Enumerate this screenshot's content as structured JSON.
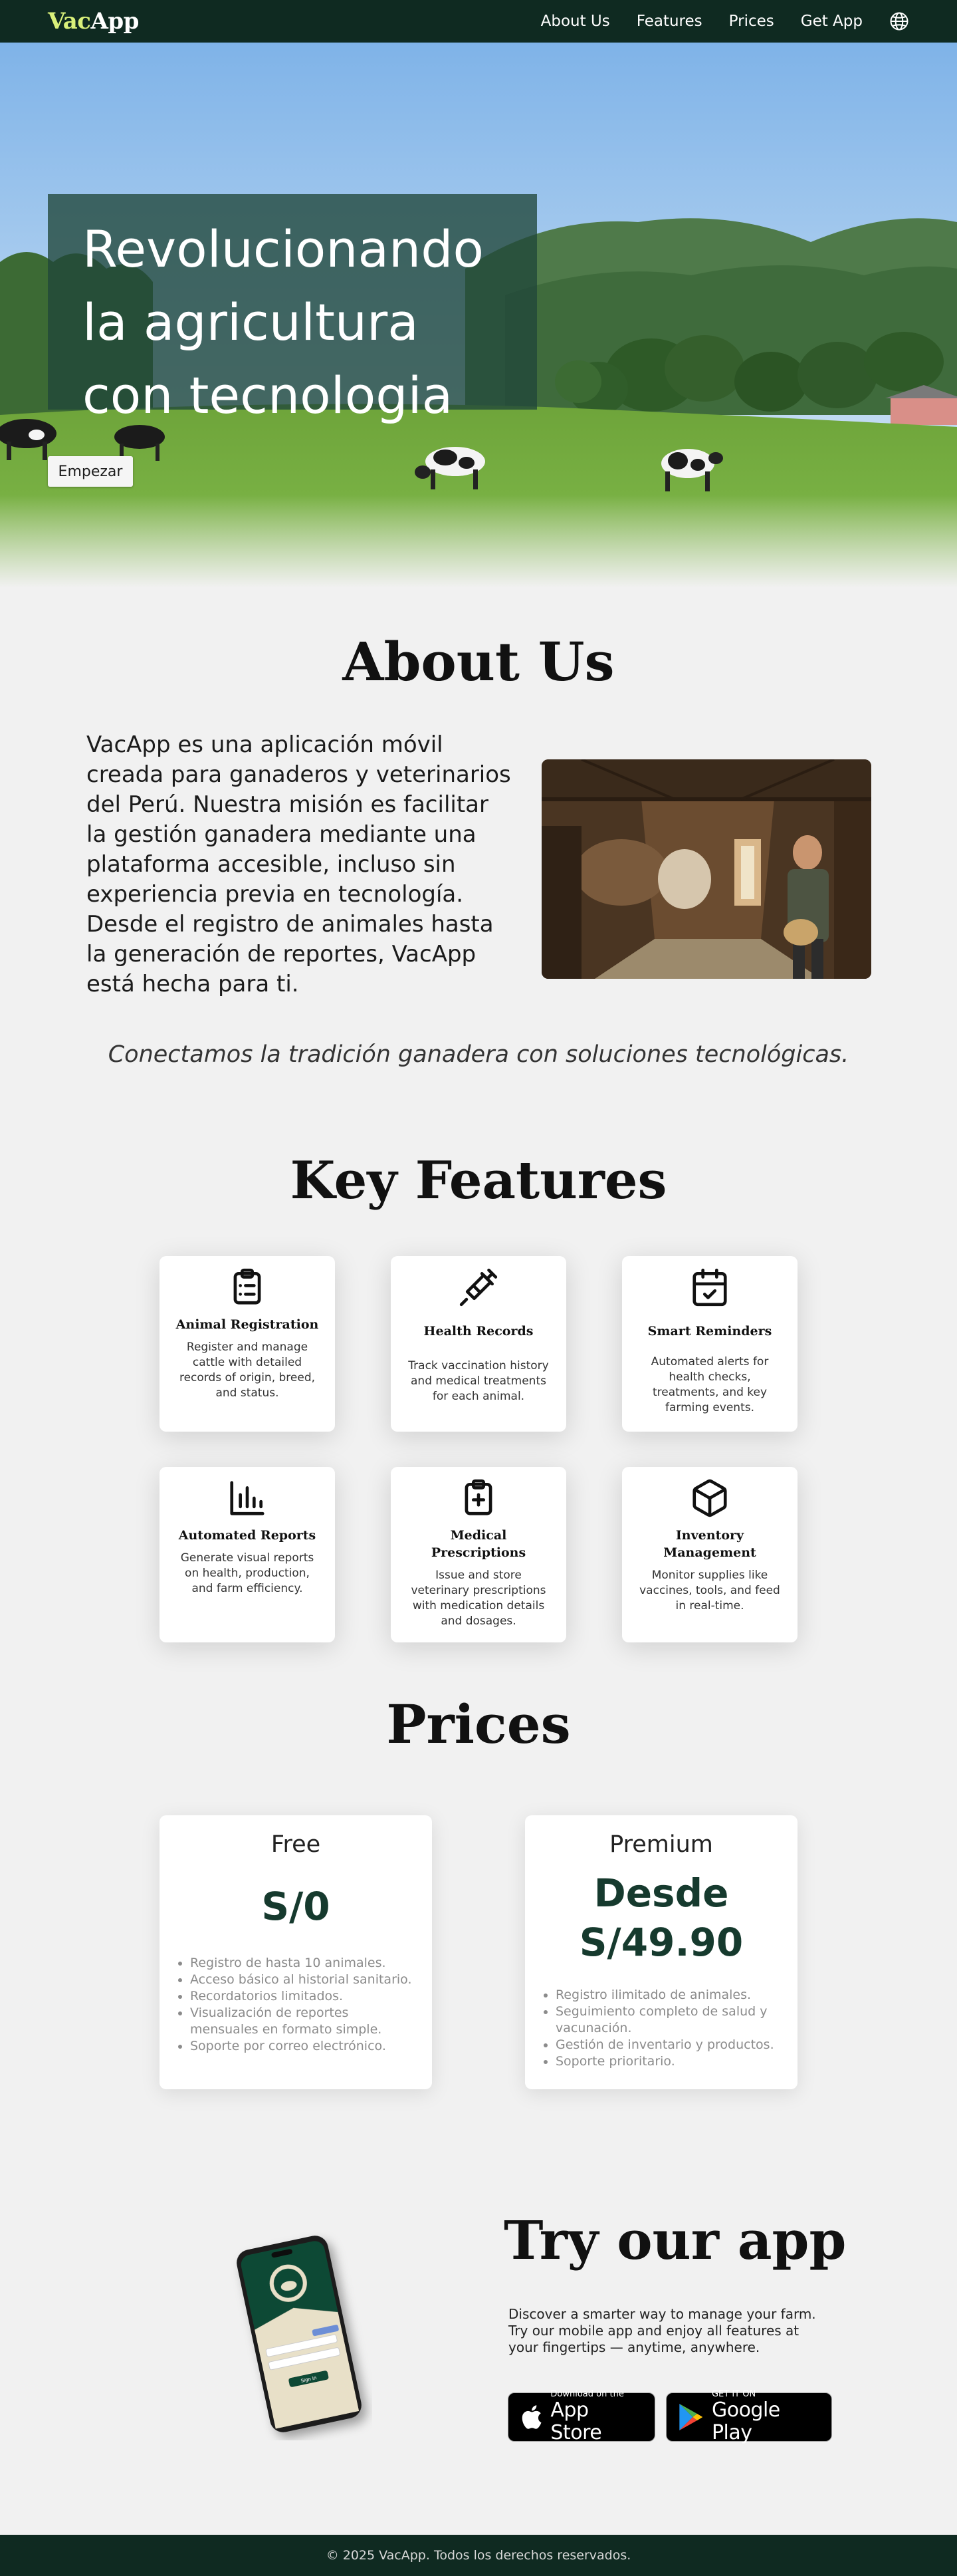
{
  "nav": {
    "brand_prefix": "Vac",
    "brand_suffix": "App",
    "links": [
      "About Us",
      "Features",
      "Prices",
      "Get App"
    ],
    "language_icon": "globe-icon"
  },
  "hero": {
    "title_lines": [
      "Revolucionando",
      "la agricultura",
      "con tecnologia"
    ],
    "cta_label": "Empezar"
  },
  "about": {
    "title": "About Us",
    "text": "VacApp es una aplicación móvil creada para ganaderos y veterinarios del  Perú. Nuestra misión es facilitar la gestión ganadera mediante una  plataforma accesible, incluso sin experiencia previa en tecnología.  Desde el registro de animales hasta la generación de reportes, VacApp  está hecha para ti.",
    "quote": "Conectamos la tradición ganadera con soluciones tecnológicas."
  },
  "features": {
    "title": "Key Features",
    "items": [
      {
        "name": "Animal Registration",
        "desc": "Register and manage cattle with detailed records of origin, breed, and status.",
        "icon": "clipboard-list-icon"
      },
      {
        "name": "Health Records",
        "desc": "Track vaccination history and medical treatments for each animal.",
        "icon": "syringe-icon"
      },
      {
        "name": "Smart Reminders",
        "desc": "Automated alerts for health checks, treatments, and key farming events.",
        "icon": "calendar-check-icon"
      },
      {
        "name": "Automated Reports",
        "desc": "Generate visual reports on health, production, and farm efficiency.",
        "icon": "bar-chart-icon"
      },
      {
        "name": "Medical Prescriptions",
        "desc": "Issue and store veterinary prescriptions with medication details and dosages.",
        "icon": "clipboard-plus-icon"
      },
      {
        "name": "Inventory Management",
        "desc": "Monitor supplies like vaccines, tools, and feed in real-time.",
        "icon": "box-icon"
      }
    ]
  },
  "prices": {
    "title": "Prices",
    "plans": [
      {
        "name": "Free",
        "price": "S/0",
        "features": [
          "Registro de hasta 10 animales.",
          "Acceso básico al historial sanitario.",
          "Recordatorios limitados.",
          "Visualización de reportes mensuales en formato simple.",
          "Soporte por correo electrónico."
        ]
      },
      {
        "name": "Premium",
        "price": "Desde S/49.90",
        "features": [
          "Registro ilimitado de animales.",
          "Seguimiento completo de salud y vacunación.",
          "Gestión de inventario y productos.",
          "Soporte prioritario."
        ]
      }
    ]
  },
  "app": {
    "title": "Try our app",
    "desc": "Discover a smarter way to manage your farm. Try our mobile app and enjoy all features at your fingertips — anytime, anywhere.",
    "appstore_small": "Download on the",
    "appstore_big": "App Store",
    "googleplay_small": "GET IT ON",
    "googleplay_big": "Google Play",
    "phone_button": "Sign in"
  },
  "footer": {
    "text": "© 2025 VacApp. Todos los derechos reservados."
  },
  "colors": {
    "nav_bg": "#0f2a21",
    "brand_accent": "#d9f07a",
    "price_color": "#163a2e",
    "page_bg": "#f1f1f1"
  }
}
